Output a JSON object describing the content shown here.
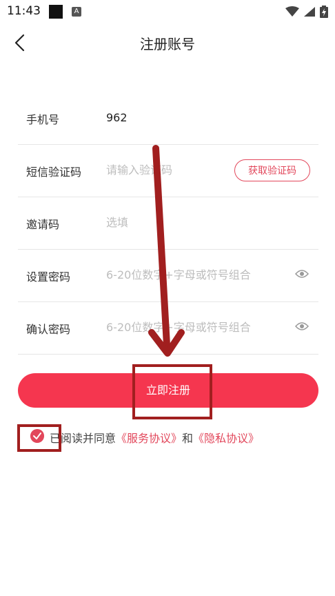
{
  "status_bar": {
    "time": "11:43",
    "a_badge": "A"
  },
  "nav": {
    "title": "注册账号"
  },
  "form": {
    "phone": {
      "label": "手机号",
      "value": "962"
    },
    "sms": {
      "label": "短信验证码",
      "placeholder": "请输入验证码",
      "button": "获取验证码"
    },
    "invite": {
      "label": "邀请码",
      "placeholder": "选填"
    },
    "password": {
      "label": "设置密码",
      "placeholder": "6-20位数字+字母或符号组合"
    },
    "confirm": {
      "label": "确认密码",
      "placeholder": "6-20位数字+字母或符号组合"
    }
  },
  "register_button": "立即注册",
  "agreement": {
    "prefix": "已阅读并同意",
    "service": "《服务协议》",
    "and": "和",
    "privacy": "《隐私协议》"
  },
  "colors": {
    "accent": "#f5364f",
    "link": "#e2475b",
    "annotation": "#a11f1f"
  }
}
